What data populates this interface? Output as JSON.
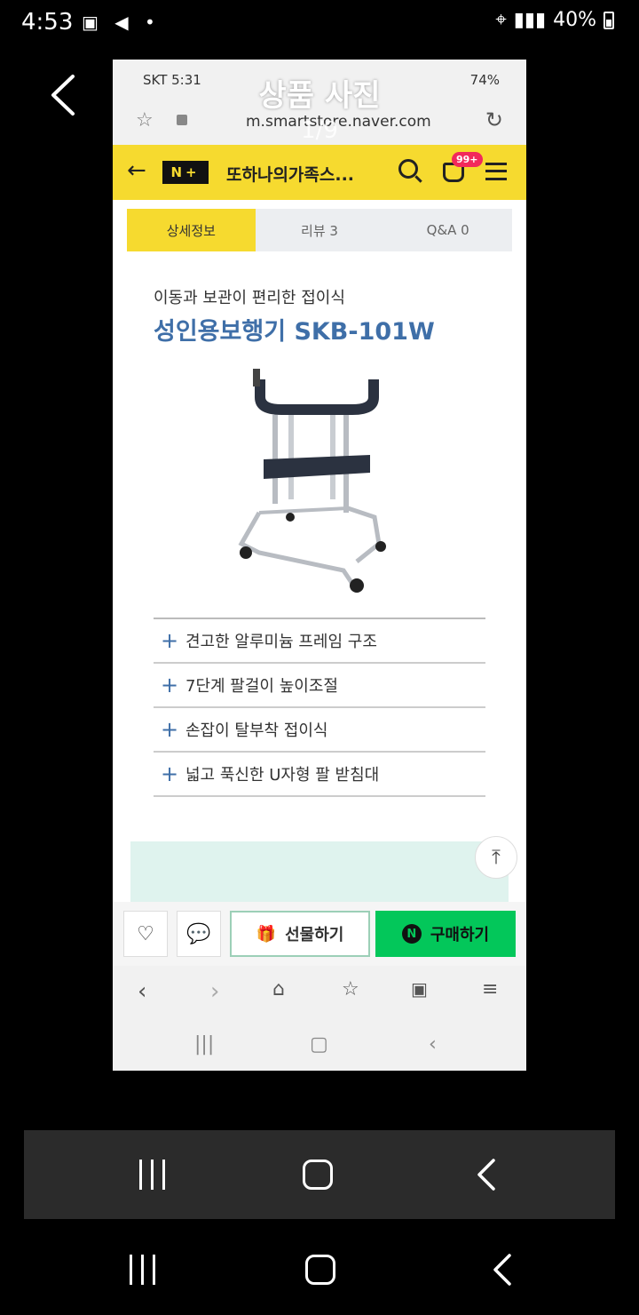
{
  "status_bar": {
    "time": "4:53",
    "right_text": "40%"
  },
  "gallery": {
    "title": "상품 사진",
    "counter": "1/9"
  },
  "inner_status": {
    "time": "SKT 5:31",
    "battery": "74%"
  },
  "browser": {
    "url": "m.smartstore.naver.com"
  },
  "store": {
    "logo_text": "N+",
    "name": "또하나의가족스...",
    "cart_badge": "99+"
  },
  "tabs": [
    {
      "label": "상세정보",
      "active": true
    },
    {
      "label": "리뷰  3",
      "active": false
    },
    {
      "label": "Q&A  0",
      "active": false
    }
  ],
  "product": {
    "subtitle": "이동과 보관이 편리한 접이식",
    "title": "성인용보행기 SKB-101W",
    "features": [
      "견고한 알루미늄 프레임 구조",
      "7단계 팔걸이 높이조절",
      "손잡이 탈부착 접이식",
      "넓고 푹신한 U자형 팔 받침대"
    ]
  },
  "buy_bar": {
    "gift_label": "선물하기",
    "buy_label": "구매하기",
    "n_logo": "N"
  },
  "icons": {
    "inner_status": "notification-icons",
    "star": "bookmark-star-icon",
    "reload": "reload-icon",
    "walker": "product-walker-image"
  }
}
